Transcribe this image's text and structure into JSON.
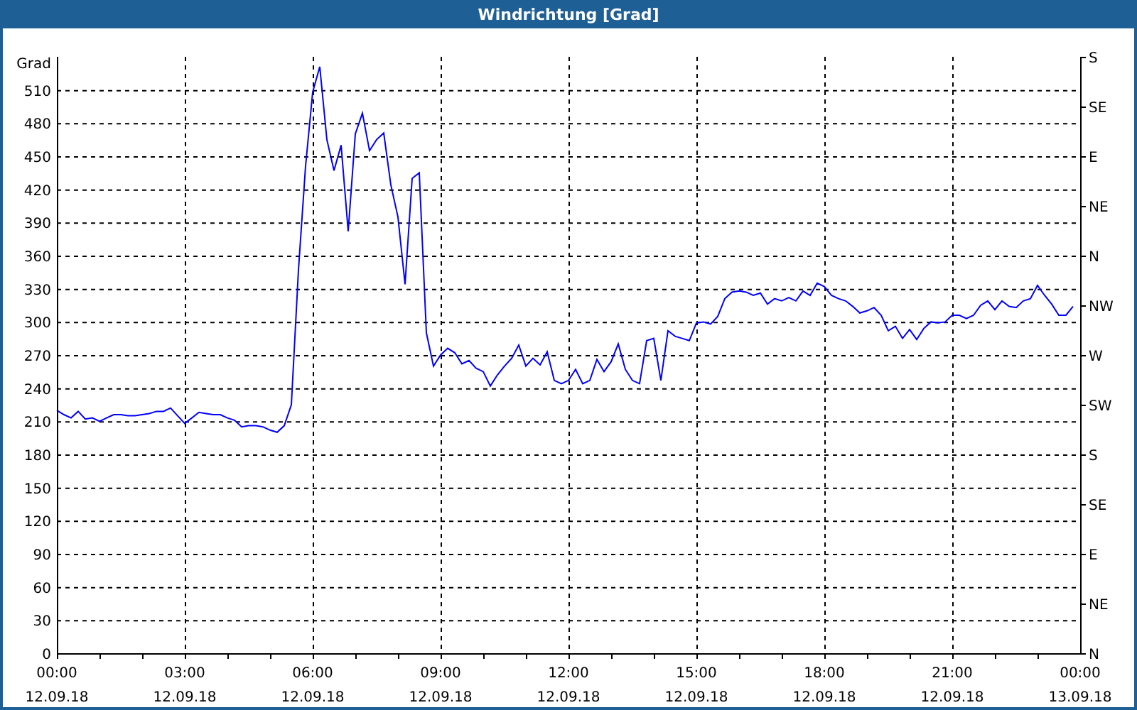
{
  "window": {
    "title": "Windrichtung [Grad]"
  },
  "chart": {
    "compass_labels": [
      "S",
      "SE",
      "E",
      "NE",
      "N",
      "NW",
      "W",
      "SW",
      "S",
      "SE",
      "E",
      "NE",
      "N"
    ],
    "chart_data": {
      "type": "line",
      "grid": true,
      "ylabel": "Grad",
      "ylim": [
        0,
        540
      ],
      "yticks": [
        0,
        30,
        60,
        90,
        120,
        150,
        180,
        210,
        240,
        270,
        300,
        330,
        360,
        390,
        420,
        450,
        480,
        510
      ],
      "categories": [
        "00:00\n12.09.18",
        null,
        null,
        null,
        null,
        null,
        null,
        null,
        null,
        null,
        null,
        null,
        null,
        null,
        null,
        null,
        null,
        null,
        "03:00\n12.09.18",
        null,
        null,
        null,
        null,
        null,
        null,
        null,
        null,
        null,
        null,
        null,
        null,
        null,
        null,
        null,
        null,
        null,
        "06:00\n12.09.18",
        null,
        null,
        null,
        null,
        null,
        null,
        null,
        null,
        null,
        null,
        null,
        null,
        null,
        null,
        null,
        null,
        null,
        "09:00\n12.09.18",
        null,
        null,
        null,
        null,
        null,
        null,
        null,
        null,
        null,
        null,
        null,
        null,
        null,
        null,
        null,
        null,
        null,
        "12:00\n12.09.18",
        null,
        null,
        null,
        null,
        null,
        null,
        null,
        null,
        null,
        null,
        null,
        null,
        null,
        null,
        null,
        null,
        null,
        "15:00\n12.09.18",
        null,
        null,
        null,
        null,
        null,
        null,
        null,
        null,
        null,
        null,
        null,
        null,
        null,
        null,
        null,
        null,
        null,
        "18:00\n12.09.18",
        null,
        null,
        null,
        null,
        null,
        null,
        null,
        null,
        null,
        null,
        null,
        null,
        null,
        null,
        null,
        null,
        null,
        "21:00\n12.09.18",
        null,
        null,
        null,
        null,
        null,
        null,
        null,
        null,
        null,
        null,
        null,
        null,
        null,
        null,
        null,
        null,
        null,
        "00:00\n13.09.18"
      ],
      "series": [
        {
          "color": "#0000ff",
          "values": [
            220,
            216,
            213,
            219,
            212,
            213,
            210,
            213,
            216,
            216,
            215,
            215,
            216,
            217,
            219,
            219,
            222,
            215,
            208,
            213,
            218,
            217,
            216,
            216,
            213,
            211,
            205,
            206,
            206,
            205,
            202,
            200,
            206,
            225,
            347,
            441,
            508,
            531,
            465,
            437,
            460,
            382,
            470,
            489,
            455,
            465,
            471,
            424,
            395,
            334,
            430,
            435,
            290,
            260,
            270,
            276,
            272,
            262,
            265,
            258,
            255,
            242,
            252,
            260,
            267,
            279,
            260,
            267,
            261,
            273,
            247,
            244,
            247,
            257,
            244,
            247,
            266,
            255,
            264,
            280,
            257,
            247,
            244,
            283,
            285,
            247,
            292,
            287,
            285,
            283,
            299,
            300,
            298,
            305,
            321,
            327,
            328,
            327,
            324,
            326,
            316,
            321,
            319,
            322,
            319,
            328,
            324,
            335,
            332,
            324,
            321,
            319,
            314,
            308,
            310,
            313,
            306,
            292,
            296,
            285,
            293,
            284,
            294,
            300,
            299,
            300,
            306,
            306,
            303,
            306,
            315,
            319,
            311,
            319,
            314,
            313,
            319,
            321,
            333,
            324,
            316,
            306,
            306,
            314,
            null
          ]
        }
      ]
    }
  }
}
